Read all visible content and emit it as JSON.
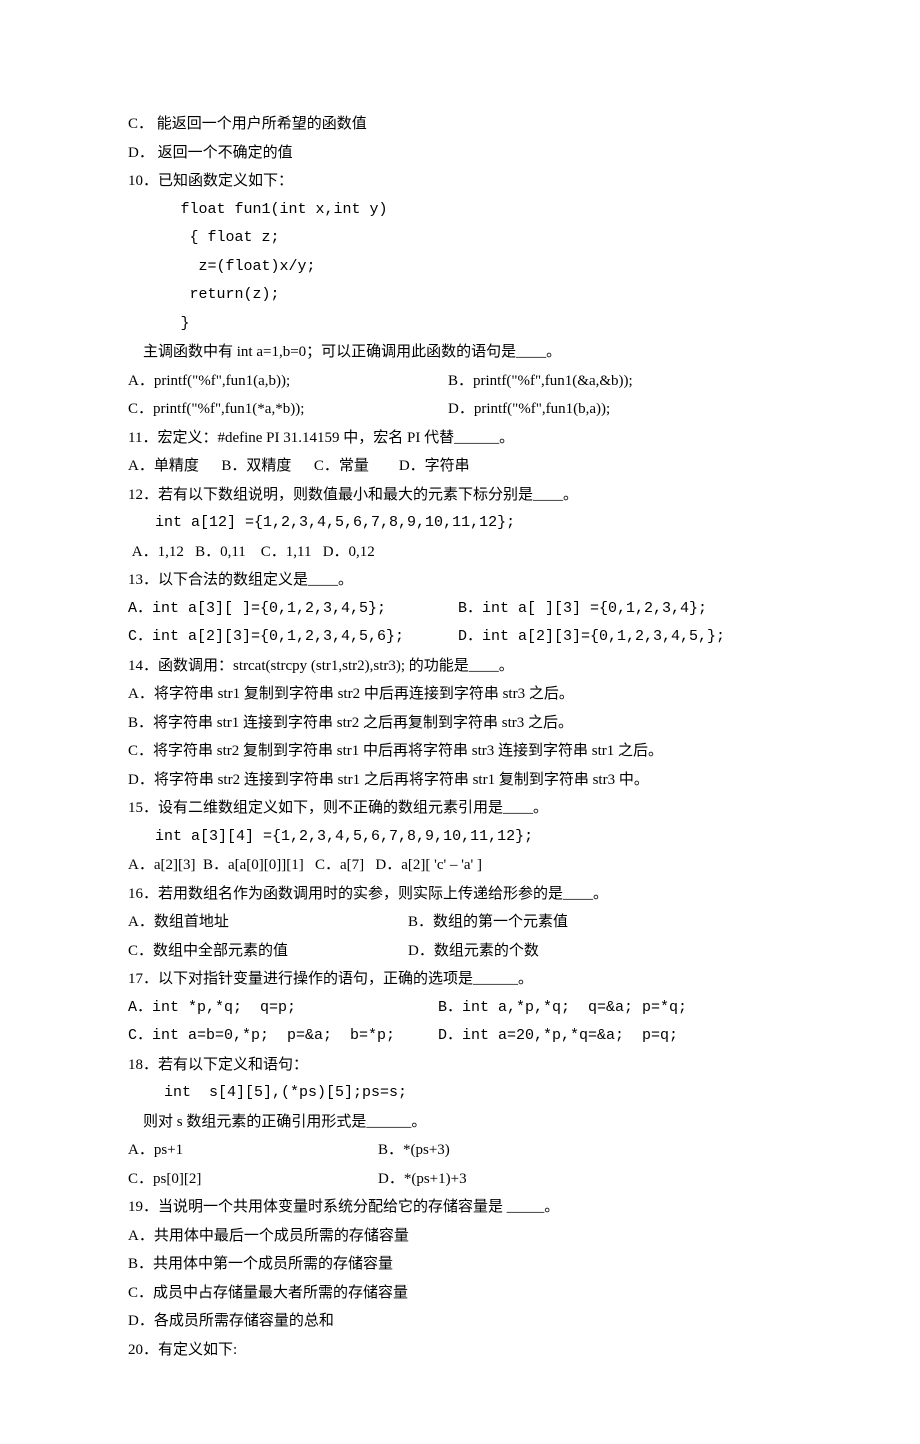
{
  "lines": {
    "l1": "C． 能返回一个用户所希望的函数值",
    "l2": "D． 返回一个不确定的值",
    "l3": "10．已知函数定义如下：",
    "l4": "float fun1(int x,int y)",
    "l5": " { float z;",
    "l6": "  z=(float)x/y;",
    "l7": " return(z);",
    "l8": "}",
    "l9": "    主调函数中有 int a=1,b=0；可以正确调用此函数的语句是____。",
    "l10a": "A．printf(\"%f\",fun1(a,b));",
    "l10b": "B．printf(\"%f\",fun1(&a,&b));",
    "l11a": "C．printf(\"%f\",fun1(*a,*b));",
    "l11b": "D．printf(\"%f\",fun1(b,a));",
    "l12": "11．宏定义：#define PI 31.14159 中，宏名 PI 代替______。",
    "l13": "A．单精度      B．双精度      C．常量        D．字符串",
    "l14": "12．若有以下数组说明，则数值最小和最大的元素下标分别是____。",
    "l15": "   int a[12] ={1,2,3,4,5,6,7,8,9,10,11,12};",
    "l16": " A．1,12   B．0,11    C．1,11   D．0,12",
    "l17": "13．以下合法的数组定义是____。",
    "l18a": "A．int a[3][ ]={0,1,2,3,4,5};",
    "l18b": "B．int a[ ][3] ={0,1,2,3,4};",
    "l19a": "C．int a[2][3]={0,1,2,3,4,5,6};",
    "l19b": "D．int a[2][3]={0,1,2,3,4,5,};",
    "l20": "14．函数调用：strcat(strcpy (str1,str2),str3); 的功能是____。",
    "l21": "A．将字符串 str1 复制到字符串 str2 中后再连接到字符串 str3 之后。",
    "l22": "B．将字符串 str1 连接到字符串 str2 之后再复制到字符串 str3 之后。",
    "l23": "C．将字符串 str2 复制到字符串 str1 中后再将字符串 str3 连接到字符串 str1 之后。",
    "l24": "D．将字符串 str2 连接到字符串 str1 之后再将字符串 str1 复制到字符串 str3 中。",
    "l25": "15．设有二维数组定义如下，则不正确的数组元素引用是____。",
    "l26": "   int a[3][4] ={1,2,3,4,5,6,7,8,9,10,11,12};",
    "l27": "A．a[2][3]  B．a[a[0][0]][1]   C．a[7]   D．a[2][ 'c' – 'a' ]",
    "l28": "16．若用数组名作为函数调用时的实参，则实际上传递给形参的是____。",
    "l29a": "A．数组首地址",
    "l29b": "B．数组的第一个元素值",
    "l30a": "C．数组中全部元素的值",
    "l30b": "D．数组元素的个数",
    "l31": "17．以下对指针变量进行操作的语句，正确的选项是______。",
    "l32a": "A．int *p,*q;  q=p;",
    "l32b": "B．int a,*p,*q;  q=&a; p=*q;",
    "l33a": "C．int a=b=0,*p;  p=&a;  b=*p;",
    "l33b": "D．int a=20,*p,*q=&a;  p=q;",
    "l34": "18．若有以下定义和语句：",
    "l35": "    int  s[4][5],(*ps)[5];ps=s;",
    "l36": "    则对 s 数组元素的正确引用形式是______。",
    "l37a": "A．ps+1",
    "l37b": "B．*(ps+3)",
    "l38a": "C．ps[0][2]",
    "l38b": "D．*(ps+1)+3",
    "l39": "19．当说明一个共用体变量时系统分配给它的存储容量是 _____。",
    "l40": "A．共用体中最后一个成员所需的存储容量",
    "l41": "B．共用体中第一个成员所需的存储容量",
    "l42": "C．成员中占存储量最大者所需的存储容量",
    "l43": "D．各成员所需存储容量的总和",
    "l44": "20．有定义如下:"
  }
}
